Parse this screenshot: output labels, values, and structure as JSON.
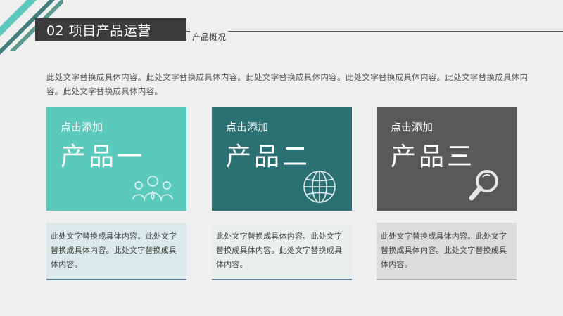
{
  "header": {
    "title": "02 项目产品运营",
    "subtitle": "产品概况"
  },
  "intro": {
    "text": "此处文字替换成具体内容。此处文字替换成具体内容。此处文字替换成具体内容。此处文字替换成具体内容。此处文字替换成具体内容。此处文字替换成具体内容。"
  },
  "products": [
    {
      "small_label": "点击添加",
      "name": "产品一",
      "icon": "people-icon",
      "color": "#5cc9bd",
      "description": "此处文字替换成具体内容。此处文字替换成具体内容。此处文字替换成具体内容。"
    },
    {
      "small_label": "点击添加",
      "name": "产品二",
      "icon": "globe-icon",
      "color": "#2b7174",
      "description": "此处文字替换成具体内容。此处文字替换成具体内容。此处文字替换成具体内容。"
    },
    {
      "small_label": "点击添加",
      "name": "产品三",
      "icon": "magnifier-icon",
      "color": "#595959",
      "description": "此处文字替换成具体内容。此处文字替换成具体内容。此处文字替换成具体内容。"
    }
  ]
}
